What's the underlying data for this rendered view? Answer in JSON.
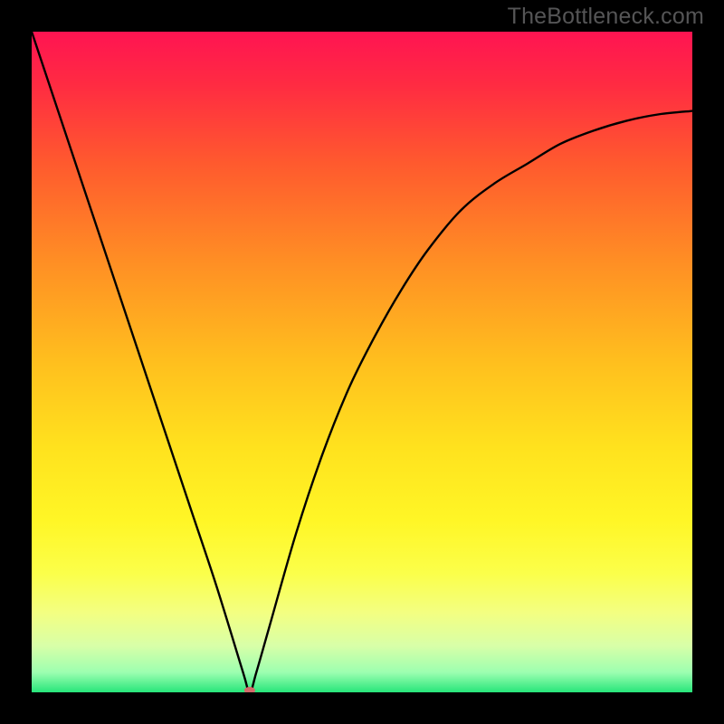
{
  "watermark": "TheBottleneck.com",
  "chart_data": {
    "type": "line",
    "title": "",
    "xlabel": "",
    "ylabel": "",
    "xlim": [
      0,
      100
    ],
    "ylim": [
      0,
      100
    ],
    "legend": false,
    "grid": false,
    "background": "rainbow-gradient-red-to-green",
    "notch_x": 33,
    "marker": {
      "x": 33,
      "y": 0,
      "color": "#d46a6a"
    },
    "series": [
      {
        "name": "bottleneck-curve",
        "x": [
          0,
          4,
          8,
          12,
          16,
          20,
          24,
          28,
          32,
          33,
          34,
          36,
          40,
          44,
          48,
          52,
          56,
          60,
          65,
          70,
          75,
          80,
          85,
          90,
          95,
          100
        ],
        "y": [
          100,
          88,
          76,
          64,
          52,
          40,
          28,
          16,
          3,
          0,
          3,
          10,
          24,
          36,
          46,
          54,
          61,
          67,
          73,
          77,
          80,
          83,
          85,
          86.5,
          87.5,
          88
        ]
      }
    ],
    "gradient_stops": [
      {
        "offset": 0.0,
        "color": "#ff1452"
      },
      {
        "offset": 0.08,
        "color": "#ff2b42"
      },
      {
        "offset": 0.2,
        "color": "#ff5a2e"
      },
      {
        "offset": 0.35,
        "color": "#ff8f24"
      },
      {
        "offset": 0.5,
        "color": "#ffbf1e"
      },
      {
        "offset": 0.63,
        "color": "#ffe21e"
      },
      {
        "offset": 0.74,
        "color": "#fff626"
      },
      {
        "offset": 0.82,
        "color": "#fbff4a"
      },
      {
        "offset": 0.88,
        "color": "#f3ff82"
      },
      {
        "offset": 0.93,
        "color": "#d8ffa8"
      },
      {
        "offset": 0.97,
        "color": "#9cffb0"
      },
      {
        "offset": 1.0,
        "color": "#27e57a"
      }
    ]
  }
}
